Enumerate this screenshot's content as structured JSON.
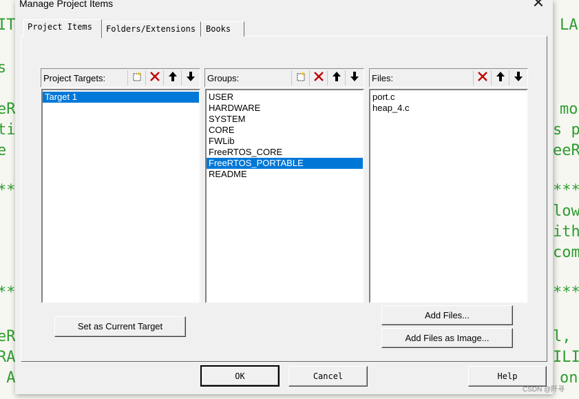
{
  "background": {
    "left_fragments": [
      "IT",
      "s ]",
      "eR",
      "ti",
      "e S",
      "**",
      "**",
      "eR",
      "RAI",
      " A"
    ],
    "right_fragments": [
      "LA",
      "mo",
      "s p",
      "eeR",
      "***",
      "low",
      "ith",
      "com",
      "***",
      "l,",
      "ILI",
      "on"
    ]
  },
  "dialog": {
    "title": "Manage Project Items",
    "close_glyph": "✕",
    "tabs": [
      {
        "label": "Project Items"
      },
      {
        "label": "Folders/Extensions"
      },
      {
        "label": "Books"
      }
    ],
    "active_tab": "Project Items"
  },
  "targets": {
    "label": "Project Targets:",
    "items": [
      "Target 1"
    ],
    "selected": "Target 1",
    "tools": [
      "new-icon",
      "delete-icon",
      "move-up-icon",
      "move-down-icon"
    ]
  },
  "groups": {
    "label": "Groups:",
    "items": [
      "USER",
      "HARDWARE",
      "SYSTEM",
      "CORE",
      "FWLib",
      "FreeRTOS_CORE",
      "FreeRTOS_PORTABLE",
      "README"
    ],
    "selected": "FreeRTOS_PORTABLE",
    "tools": [
      "new-icon",
      "delete-icon",
      "move-up-icon",
      "move-down-icon"
    ]
  },
  "files": {
    "label": "Files:",
    "items": [
      "port.c",
      "heap_4.c"
    ],
    "tools": [
      "delete-icon",
      "move-up-icon",
      "move-down-icon"
    ]
  },
  "buttons": {
    "set_current_target": "Set as Current Target",
    "add_files": "Add Files...",
    "add_files_as_image": "Add Files as Image...",
    "ok": "OK",
    "cancel": "Cancel",
    "help": "Help"
  },
  "colors": {
    "selection": "#0078d7",
    "delete_red": "#c00000",
    "code_green": "#2f9d2f"
  },
  "watermark": "CSDN @阡寻"
}
